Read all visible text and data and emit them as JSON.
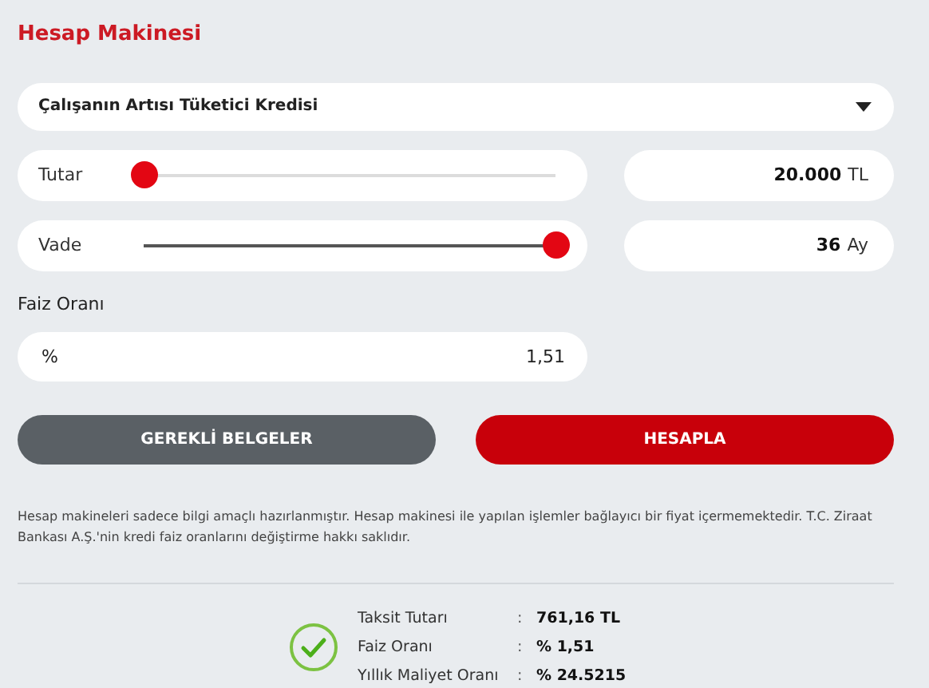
{
  "title": "Hesap Makinesi",
  "product_select": {
    "value": "Çalışanın Artısı Tüketici Kredisi"
  },
  "sliders": [
    {
      "label": "Tutar",
      "level": 0,
      "value": "20.000",
      "unit": "TL"
    },
    {
      "label": "Vade",
      "level": 1,
      "value": "36",
      "unit": "Ay"
    }
  ],
  "rate": {
    "label": "Faiz Oranı",
    "prefix": "%",
    "value": "1,51"
  },
  "buttons": [
    {
      "label": "GEREKLİ BELGELER",
      "kind": "secondary"
    },
    {
      "label": "HESAPLA",
      "kind": "primary"
    }
  ],
  "disclaimer": "Hesap makineleri sadece bilgi amaçlı hazırlanmıştır. Hesap makinesi ile yapılan işlemler bağlayıcı bir fiyat içermemektedir. T.C. Ziraat Bankası A.Ş.'nin kredi faiz oranlarını değiştirme hakkı saklıdır.",
  "results": [
    {
      "label": "Taksit Tutarı",
      "separator": ":",
      "value": "761,16 TL"
    },
    {
      "label": "Faiz Oranı",
      "separator": ":",
      "value": "% 1,51"
    },
    {
      "label": "Yıllık Maliyet Oranı",
      "separator": ":",
      "value": "% 24.5215"
    }
  ]
}
